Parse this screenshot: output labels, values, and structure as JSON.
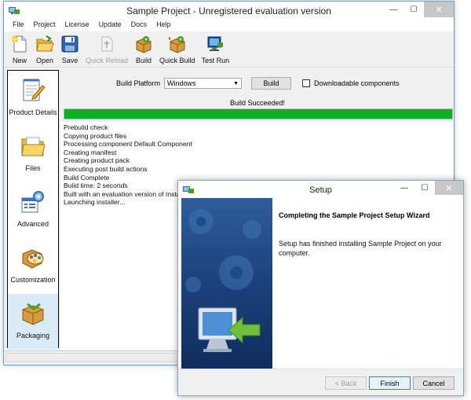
{
  "main_window": {
    "title": "Sample Project - Unregistered evaluation version",
    "menu": [
      "File",
      "Project",
      "License",
      "Update",
      "Docs",
      "Help"
    ],
    "toolbar": [
      {
        "label": "New",
        "icon": "new-document-icon",
        "enabled": true
      },
      {
        "label": "Open",
        "icon": "open-folder-icon",
        "enabled": true
      },
      {
        "label": "Save",
        "icon": "save-disk-icon",
        "enabled": true
      },
      {
        "label": "Quick Reload",
        "icon": "reload-document-icon",
        "enabled": false
      },
      {
        "label": "Build",
        "icon": "build-package-icon",
        "enabled": true
      },
      {
        "label": "Quick Build",
        "icon": "quick-build-icon",
        "enabled": true
      },
      {
        "label": "Test Run",
        "icon": "test-run-monitor-icon",
        "enabled": true
      }
    ],
    "sidebar": [
      {
        "label": "Product Details",
        "icon": "notepad-pencil-icon",
        "active": false
      },
      {
        "label": "Files",
        "icon": "folder-files-icon",
        "active": false
      },
      {
        "label": "Advanced",
        "icon": "advanced-settings-icon",
        "active": false
      },
      {
        "label": "Customization",
        "icon": "palette-box-icon",
        "active": false
      },
      {
        "label": "Packaging",
        "icon": "package-box-icon",
        "active": true
      }
    ],
    "build_platform": {
      "label": "Build Platform",
      "selected": "Windows",
      "build_button": "Build",
      "downloadable_label": "Downloadable components",
      "downloadable_checked": false
    },
    "status": "Build Succeeded!",
    "progress": 1.0,
    "progress_color": "#06b025",
    "log": [
      "Prebuild check",
      "Copying product files",
      "Processing component Default Component",
      "Creating manifest",
      "Creating product pack",
      "Executing post build actions",
      "Build Complete",
      "Build time: 2 seconds",
      "Built with an evaluation version of Instal",
      "Launching installer..."
    ]
  },
  "setup_dialog": {
    "title": "Setup",
    "heading": "Completing the Sample Project Setup Wizard",
    "body": "Setup has finished installing Sample Project on your computer.",
    "buttons": {
      "back": "< Back",
      "finish": "Finish",
      "cancel": "Cancel"
    }
  }
}
